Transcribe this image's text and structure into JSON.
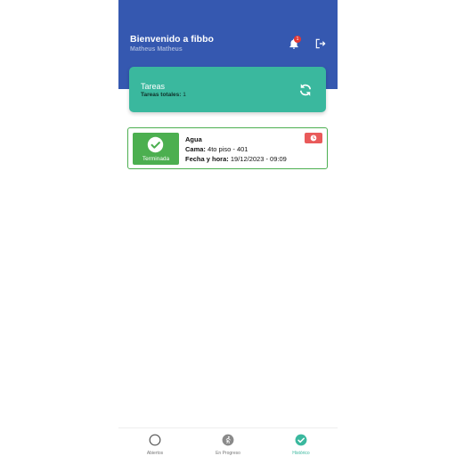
{
  "colors": {
    "header": "#3558b0",
    "accent": "#3ab89e",
    "done": "#4caf50",
    "badge": "#e53935"
  },
  "header": {
    "welcome": "Bienvenido a fibbo",
    "user_name": "Matheus Matheus",
    "notification_count": "1",
    "icons": [
      "bell-icon",
      "logout-icon"
    ]
  },
  "summary": {
    "title": "Tareas",
    "total_label": "Tareas totales:",
    "total_value": "1",
    "icon": "refresh-icon"
  },
  "tasks": [
    {
      "status": "Terminada",
      "name": "Agua",
      "bed_label": "Cama:",
      "bed_value": "4to piso - 401",
      "datetime_label": "Fecha y hora:",
      "datetime_value": "19/12/2023 - 09:09"
    }
  ],
  "nav": [
    {
      "label": "Abiertos",
      "icon": "circle-outline-icon",
      "active": false
    },
    {
      "label": "En Progreso",
      "icon": "running-person-icon",
      "active": false
    },
    {
      "label": "Histórico",
      "icon": "check-circle-icon",
      "active": true
    }
  ]
}
